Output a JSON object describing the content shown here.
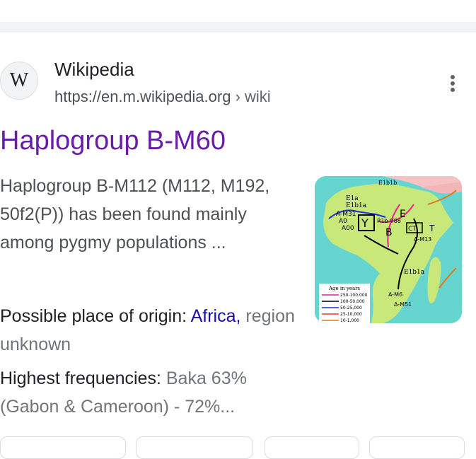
{
  "result": {
    "site_name": "Wikipedia",
    "url_base": "https://en.m.wikipedia.org",
    "url_sep": " › ",
    "url_path": "wiki",
    "favicon_letter": "W",
    "title": "Haplogroup B-M60",
    "snippet": "Haplogroup B-M112 (M112, M192, 50f2(P)) has been found mainly among pygmy populations ...",
    "attributes": [
      {
        "key": "Possible place of origin: ",
        "link": "Africa,",
        "value": " region unknown"
      },
      {
        "key": "Highest frequencies: ",
        "value": "Baka 63% (Gabon & Cameroon) - 72%..."
      }
    ],
    "thumbnail": {
      "labels": [
        "E1b1b",
        "E1a",
        "E1b1a",
        "A-M31",
        "A0",
        "A00",
        "Y",
        "R1b-V88",
        "E",
        "CT",
        "T",
        "B",
        "A-M13",
        "E1b1a",
        "A-M6",
        "A-M51",
        "Age in years",
        "250-100,000",
        "100-50,000",
        "50-25,000",
        "25-10,000",
        "10-1,000"
      ]
    }
  },
  "colors": {
    "link_visited": "#681da8",
    "link": "#1a0dab",
    "text_primary": "#202124",
    "text_secondary": "#70757a"
  }
}
